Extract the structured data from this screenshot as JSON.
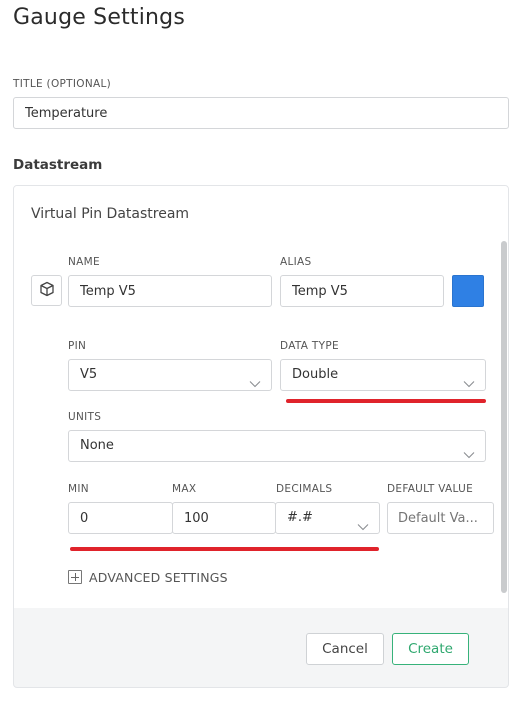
{
  "page": {
    "title": "Gauge Settings"
  },
  "title_field": {
    "label": "TITLE (OPTIONAL)",
    "value": "Temperature"
  },
  "datastream": {
    "section_title": "Datastream",
    "card_title": "Virtual Pin Datastream",
    "name": {
      "label": "NAME",
      "value": "Temp V5"
    },
    "alias": {
      "label": "ALIAS",
      "value": "Temp V5"
    },
    "color": "#2f80e4",
    "pin": {
      "label": "PIN",
      "value": "V5"
    },
    "data_type": {
      "label": "DATA TYPE",
      "value": "Double"
    },
    "units": {
      "label": "UNITS",
      "value": "None"
    },
    "min": {
      "label": "MIN",
      "value": "0"
    },
    "max": {
      "label": "MAX",
      "value": "100"
    },
    "decimals": {
      "label": "DECIMALS",
      "value": "#.#"
    },
    "default_value": {
      "label": "DEFAULT VALUE",
      "placeholder": "Default Va..."
    },
    "advanced_settings": "ADVANCED SETTINGS"
  },
  "footer": {
    "cancel_label": "Cancel",
    "create_label": "Create"
  },
  "icons": {
    "cube": "cube-icon",
    "chevron": "chevron-down-icon",
    "plus": "plus-square-icon"
  },
  "annotation_color": "#e0232b"
}
